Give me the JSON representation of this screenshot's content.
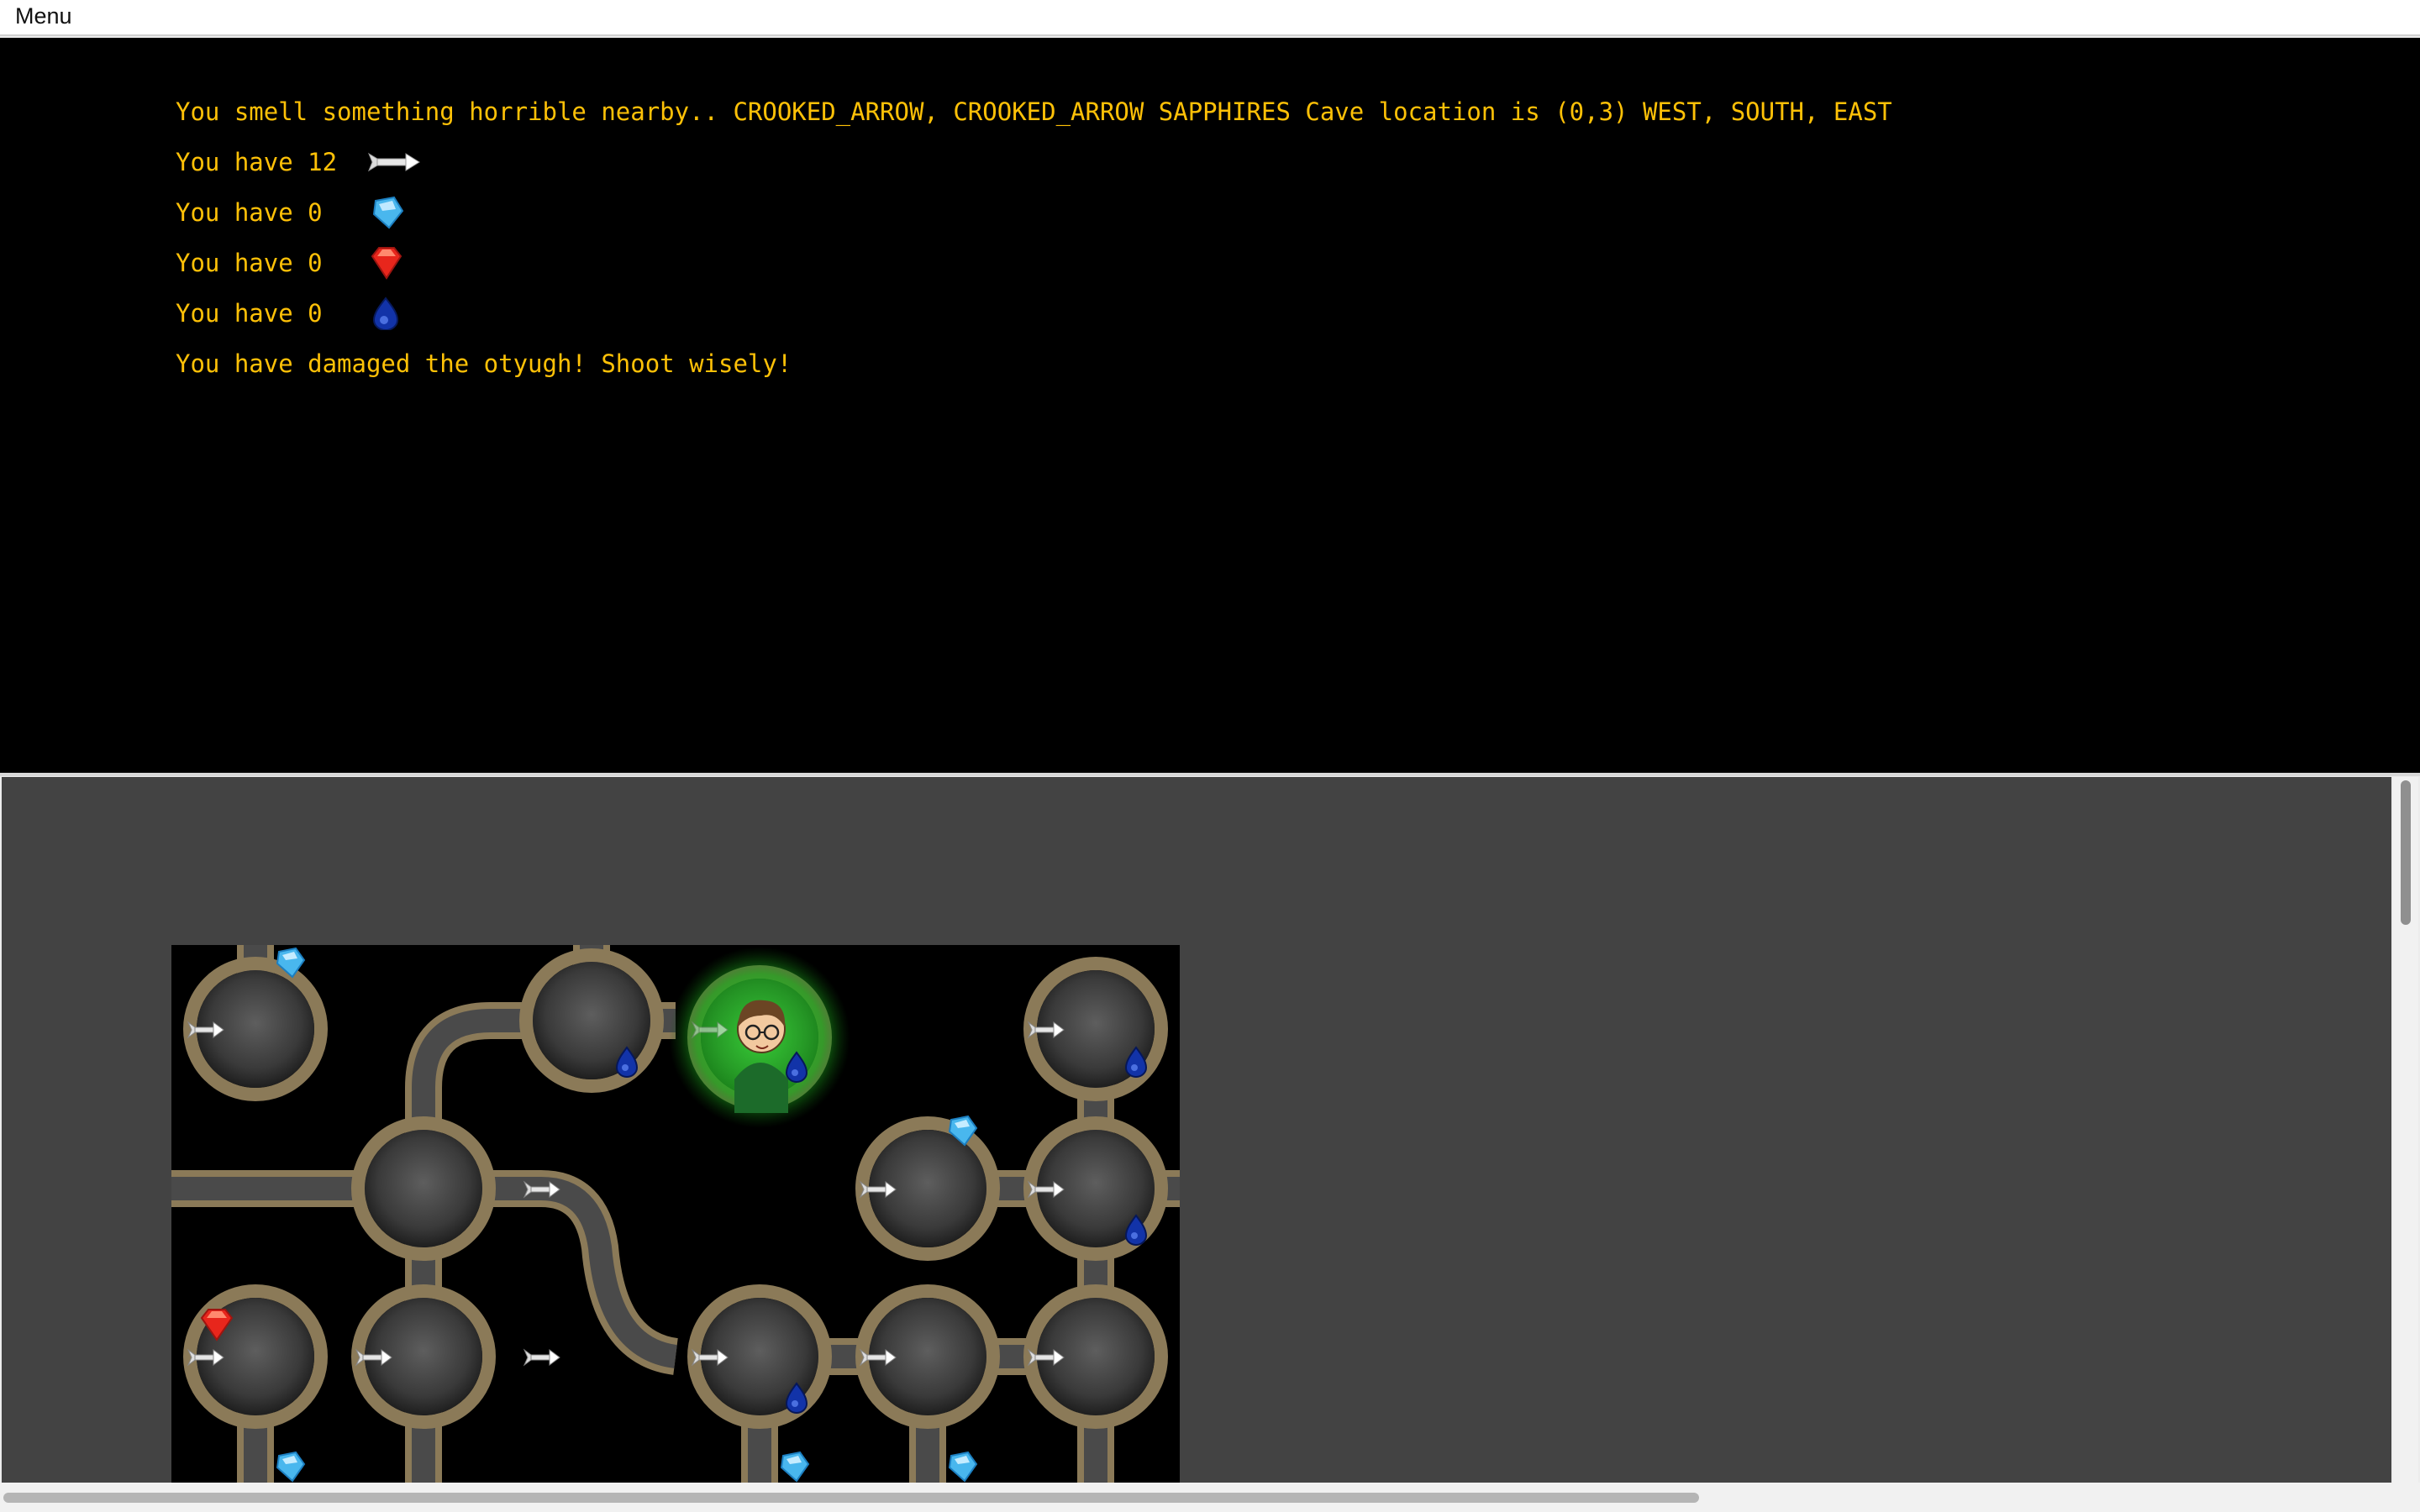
{
  "menu": {
    "label": "Menu"
  },
  "info": {
    "status_line": "You smell something horrible nearby.. CROOKED_ARROW, CROOKED_ARROW SAPPHIRES Cave location is (0,3) WEST, SOUTH, EAST",
    "arrows_text": "You have 12",
    "sapphires_text": "You have 0",
    "rubies_text": "You have 0",
    "diamonds_text": "You have 0",
    "message": "You have damaged the otyugh! Shoot wisely!"
  },
  "inventory_icons": [
    "arrow-icon",
    "sapphire-icon",
    "ruby-icon",
    "diamond-icon"
  ],
  "colors": {
    "text": "#ffc107",
    "info_bg": "#000000",
    "viewport_bg": "#434343",
    "player_glow": "#1db31d"
  },
  "map": {
    "player_cave": "(0,3)"
  }
}
